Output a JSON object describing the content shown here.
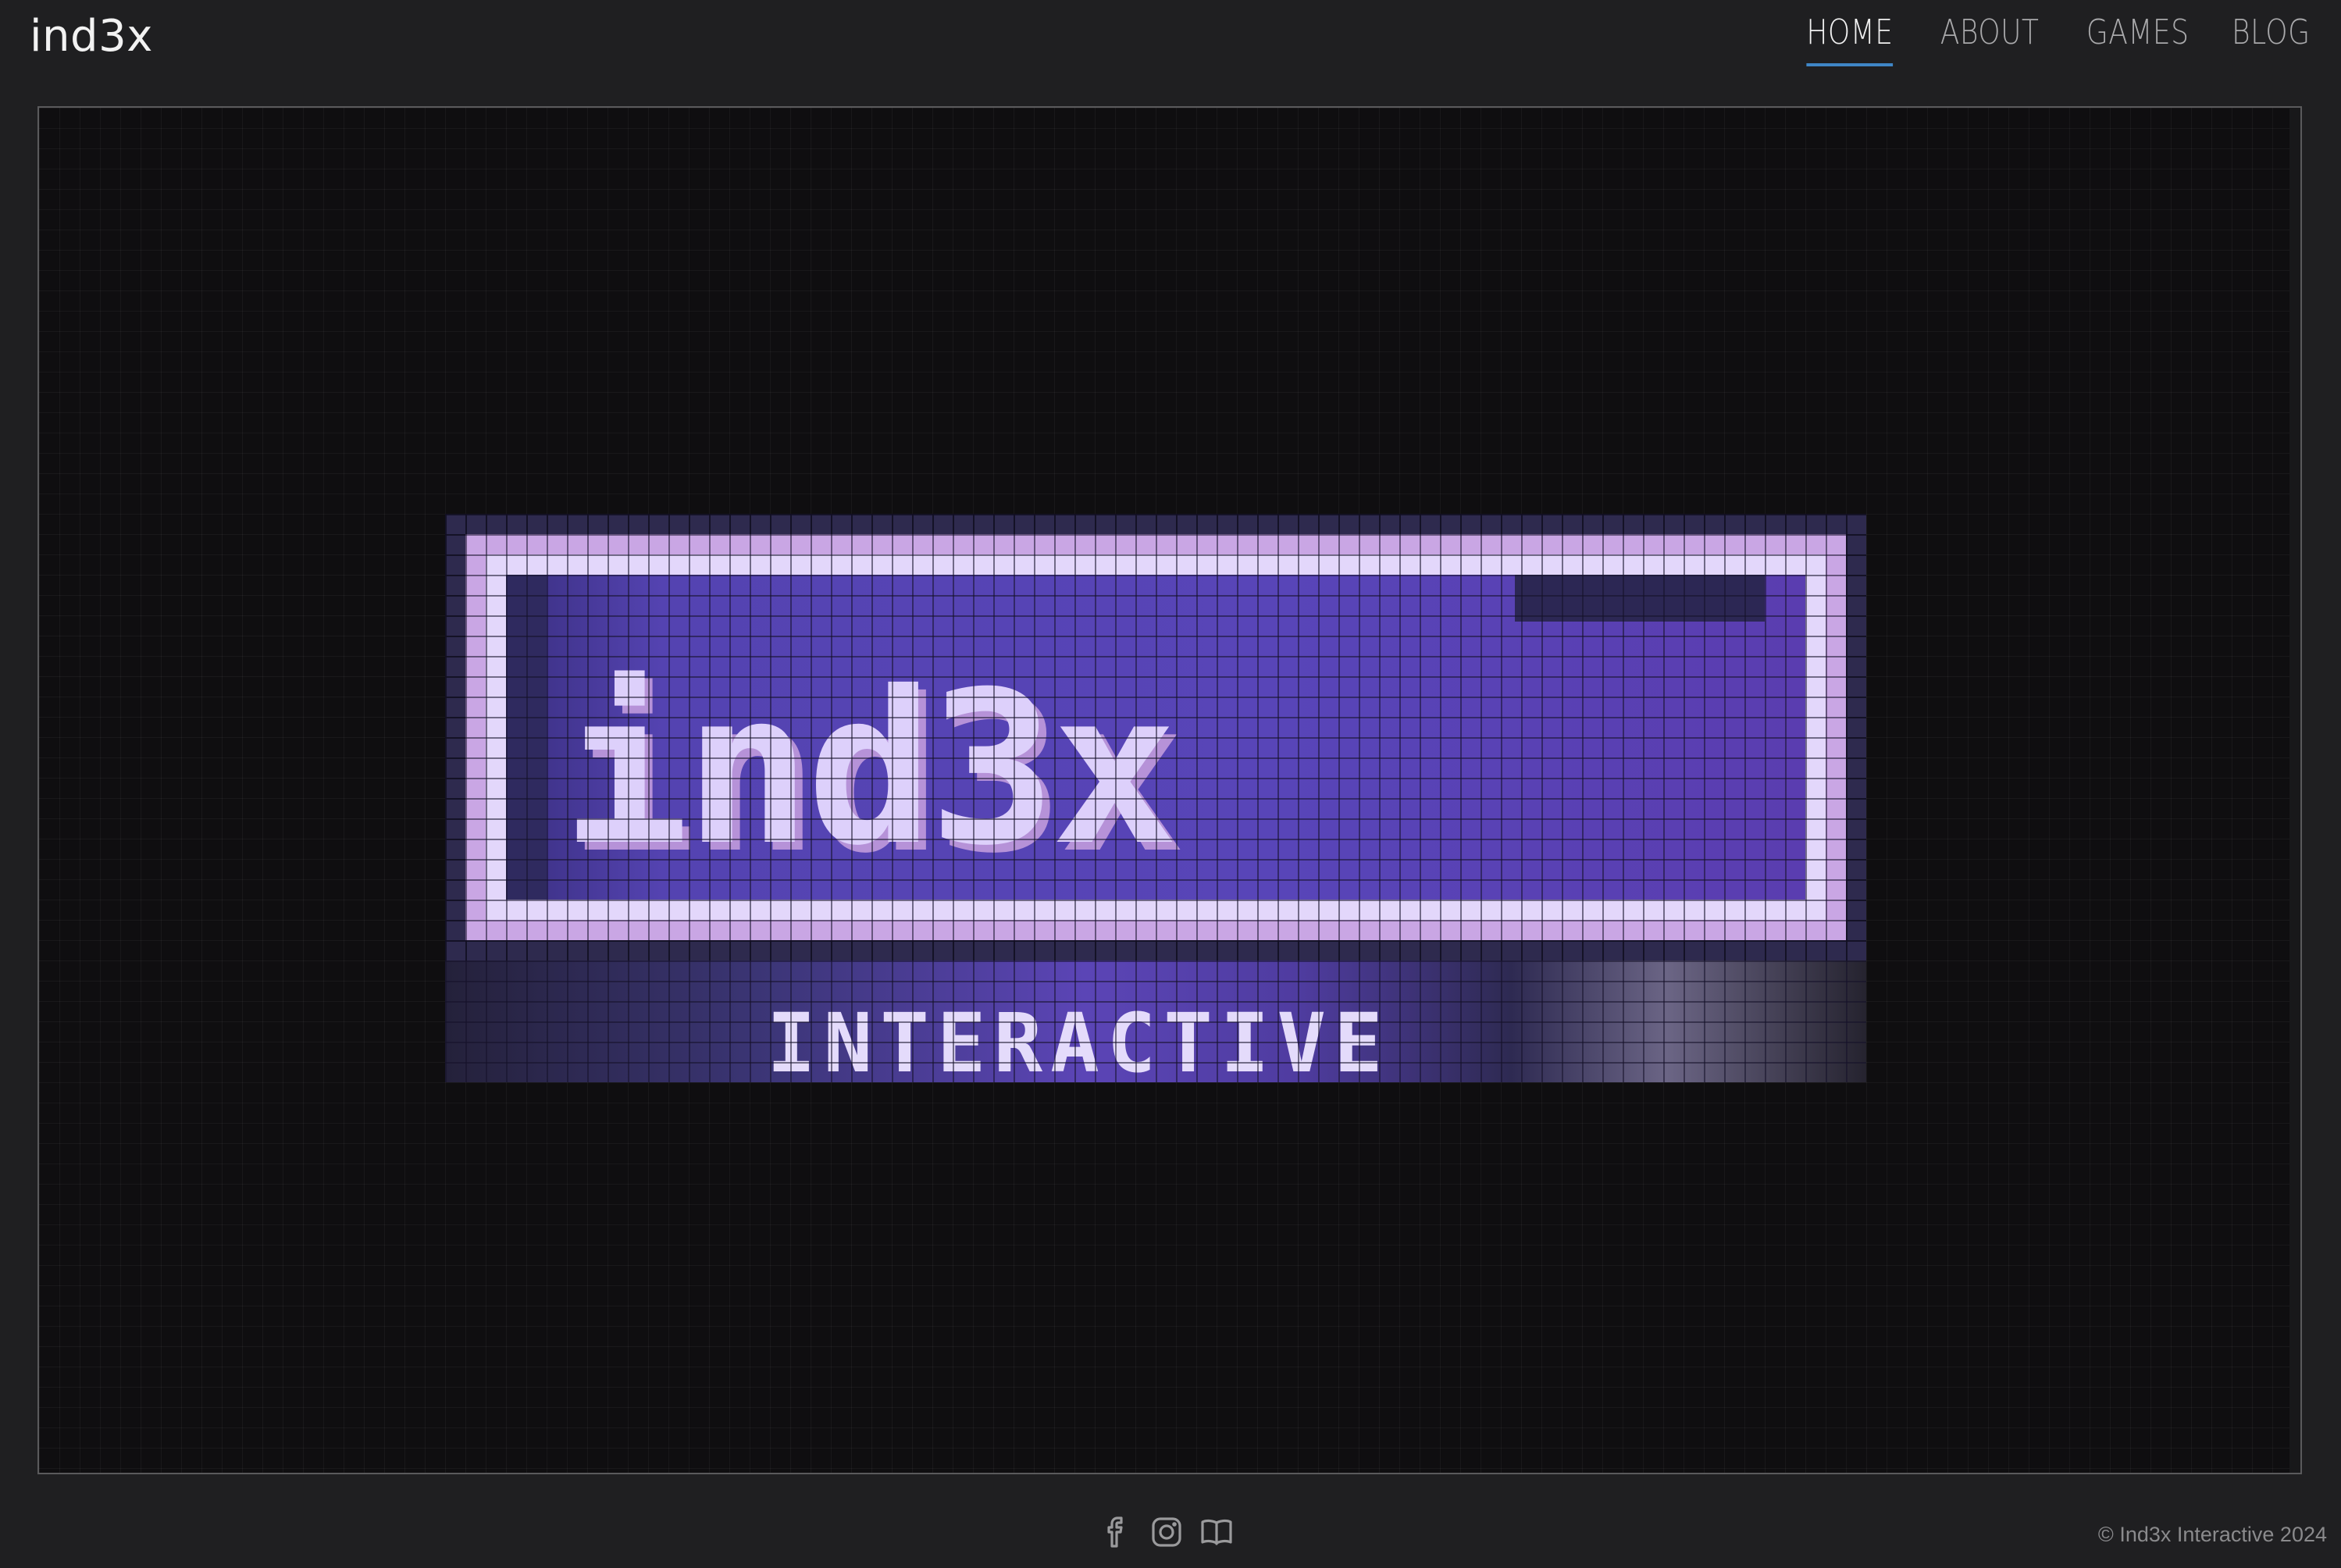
{
  "header": {
    "brand": "ind3x",
    "nav": [
      {
        "label": "HOME",
        "active": true
      },
      {
        "label": "ABOUT",
        "active": false
      },
      {
        "label": "GAMES",
        "active": false
      },
      {
        "label": "BLOG",
        "active": false
      }
    ]
  },
  "main": {
    "logo": {
      "word": "ind3x",
      "subtitle": "INTERACTIVE"
    }
  },
  "footer": {
    "social": [
      {
        "icon": "facebook-icon"
      },
      {
        "icon": "instagram-icon"
      },
      {
        "icon": "book-icon"
      }
    ],
    "copyright": "© Ind3x Interactive 2024"
  },
  "colors": {
    "background": "#1f1f21",
    "canvas": "#0f0e10",
    "accent": "#3f86c7",
    "logo_purple": "#5845b8",
    "logo_lilac": "#e3d7fb"
  }
}
